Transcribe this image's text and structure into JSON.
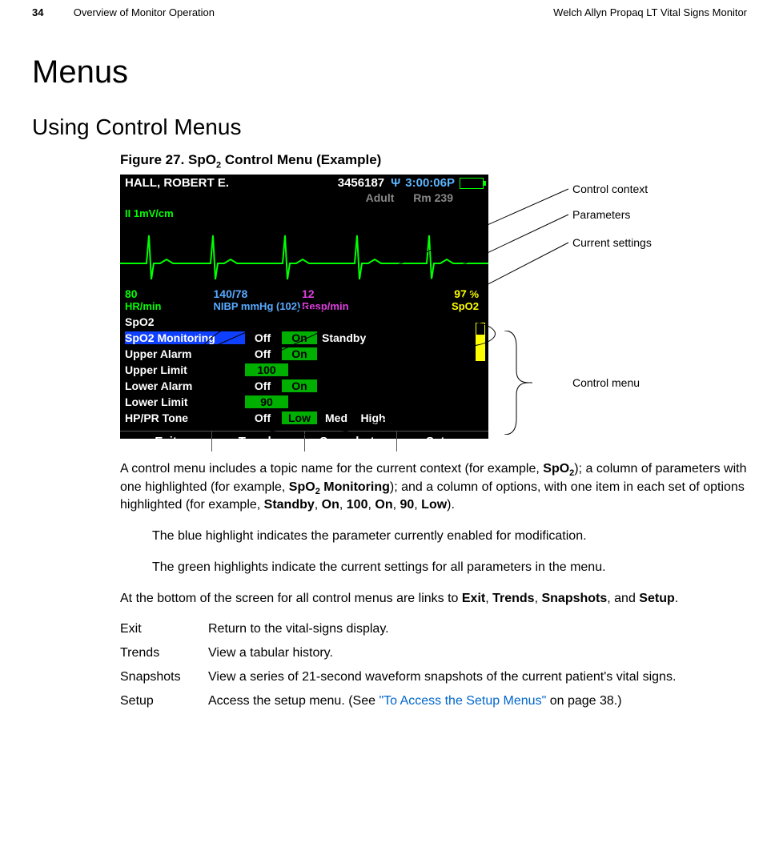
{
  "page": {
    "number": "34",
    "section": "Overview of Monitor Operation",
    "product": "Welch Allyn Propaq LT Vital Signs Monitor"
  },
  "headings": {
    "h1": "Menus",
    "h2": "Using Control Menus",
    "figcap_prefix": "Figure 27.  SpO",
    "figcap_sub": "2",
    "figcap_suffix": " Control Menu (Example)"
  },
  "screen": {
    "patient_name": "HALL, ROBERT E.",
    "patient_id": "3456187",
    "antenna_glyph": "Ψ",
    "time": "3:00:06P",
    "mode": "Adult",
    "room": "Rm 239",
    "lead": "II  1mV/cm",
    "vitals": {
      "hr_num": "80",
      "hr_lbl": "HR/min",
      "nibp_num": "140/78",
      "nibp_lbl": "NIBP mmHg (102)",
      "resp_num": "12",
      "resp_lbl": "Resp/min",
      "spo2_num": "97",
      "spo2_pct": "%",
      "spo2_lbl": "SpO2"
    },
    "context_label": "SpO2",
    "menu": {
      "rows": [
        {
          "label": "SpO2 Monitoring",
          "selected": true,
          "opts": [
            {
              "t": "Off"
            },
            {
              "t": "On",
              "g": true
            },
            {
              "t": "Standby"
            }
          ]
        },
        {
          "label": "Upper Alarm",
          "opts": [
            {
              "t": "Off"
            },
            {
              "t": "On",
              "g": true
            }
          ]
        },
        {
          "label": "Upper Limit",
          "opts": [
            {
              "t": "100",
              "gnum": true
            }
          ]
        },
        {
          "label": "Lower Alarm",
          "opts": [
            {
              "t": "Off"
            },
            {
              "t": "On",
              "g": true
            }
          ]
        },
        {
          "label": "Lower Limit",
          "opts": [
            {
              "t": "90",
              "gnum": true
            }
          ]
        },
        {
          "label": "HP/PR Tone",
          "opts": [
            {
              "t": "Off"
            },
            {
              "t": "Low",
              "g": true
            },
            {
              "t": "Med"
            },
            {
              "t": "High"
            }
          ]
        }
      ]
    },
    "bottom": {
      "exit": "Exit",
      "trends": "Trends",
      "snapshots": "Snapshots",
      "setup": "Setup"
    }
  },
  "annotations": {
    "control_context": "Control context",
    "parameters": "Parameters",
    "current_settings": "Current settings",
    "control_menu": "Control menu"
  },
  "body": {
    "p1_a": "A control menu includes a topic name for the current context (for example, ",
    "p1_b": "SpO",
    "p1_b_sub": "2",
    "p1_c": "); a column of parameters with one highlighted (for example, ",
    "p1_d": "SpO",
    "p1_d_sub": "2",
    "p1_e": " Monitoring",
    "p1_f": "); and a column of options, with one item in each set of options highlighted (for example, ",
    "p1_g": "Standby",
    "p1_h": ", ",
    "p1_i": "On",
    "p1_j": ", ",
    "p1_k": "100",
    "p1_l": ", ",
    "p1_m": "On",
    "p1_n": ", ",
    "p1_o": "90",
    "p1_p": ", ",
    "p1_q": "Low",
    "p1_r": ").",
    "p2": "The blue highlight indicates the parameter currently enabled for modification.",
    "p3": "The green highlights indicate the current settings for all parameters in the menu.",
    "p4_a": "At the bottom of the screen for all control menus are links to ",
    "p4_b": "Exit",
    "p4_c": ", ",
    "p4_d": "Trends",
    "p4_e": ", ",
    "p4_f": "Snapshots",
    "p4_g": ", and ",
    "p4_h": "Setup",
    "p4_i": "."
  },
  "defs": {
    "exit": {
      "t": "Exit",
      "d": "Return to the vital-signs display."
    },
    "trends": {
      "t": "Trends",
      "d": "View a tabular history."
    },
    "snapshots": {
      "t": "Snapshots",
      "d": "View a series of 21-second waveform snapshots of the current patient's vital signs."
    },
    "setup": {
      "t": "Setup",
      "d_a": "Access the setup menu. (See ",
      "d_link": "\"To Access the Setup Menus\"",
      "d_b": " on page 38.)"
    }
  }
}
